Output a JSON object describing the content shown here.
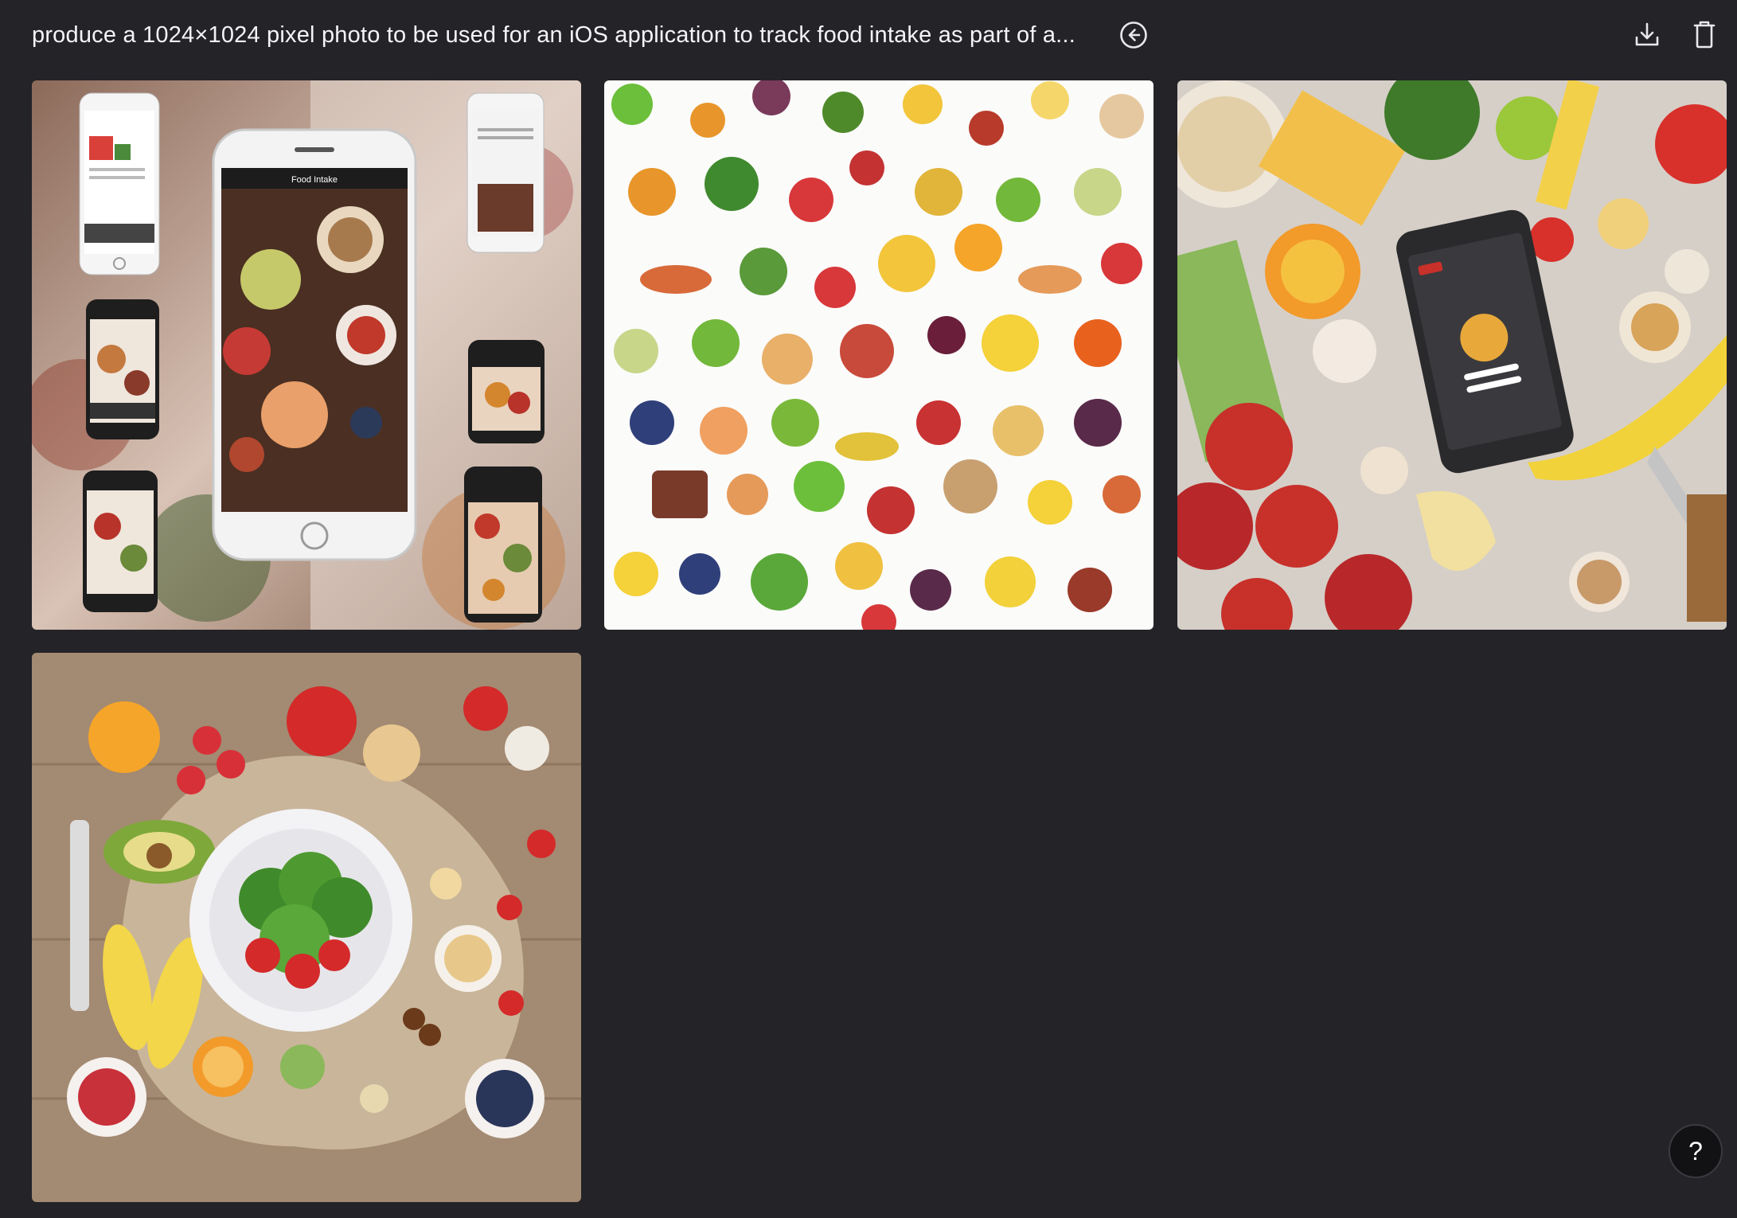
{
  "header": {
    "prompt": "produce a 1024×1024 pixel photo to be used for an iOS application to track food intake as part of a...",
    "back_icon": "arrow-left-circle-icon",
    "download_icon": "download-icon",
    "delete_icon": "trash-icon"
  },
  "gallery": {
    "images": [
      {
        "description_icon": "image-phones-food-collage"
      },
      {
        "description_icon": "image-fruits-vegetables-pattern"
      },
      {
        "description_icon": "image-phone-food-flatlay"
      },
      {
        "description_icon": "image-plate-fruits-table"
      }
    ],
    "phone_screen_title": "Food Intake"
  },
  "help": {
    "label": "?"
  },
  "colors": {
    "background": "#242328",
    "text": "#f4f4f6",
    "help_button_bg": "#121215"
  }
}
